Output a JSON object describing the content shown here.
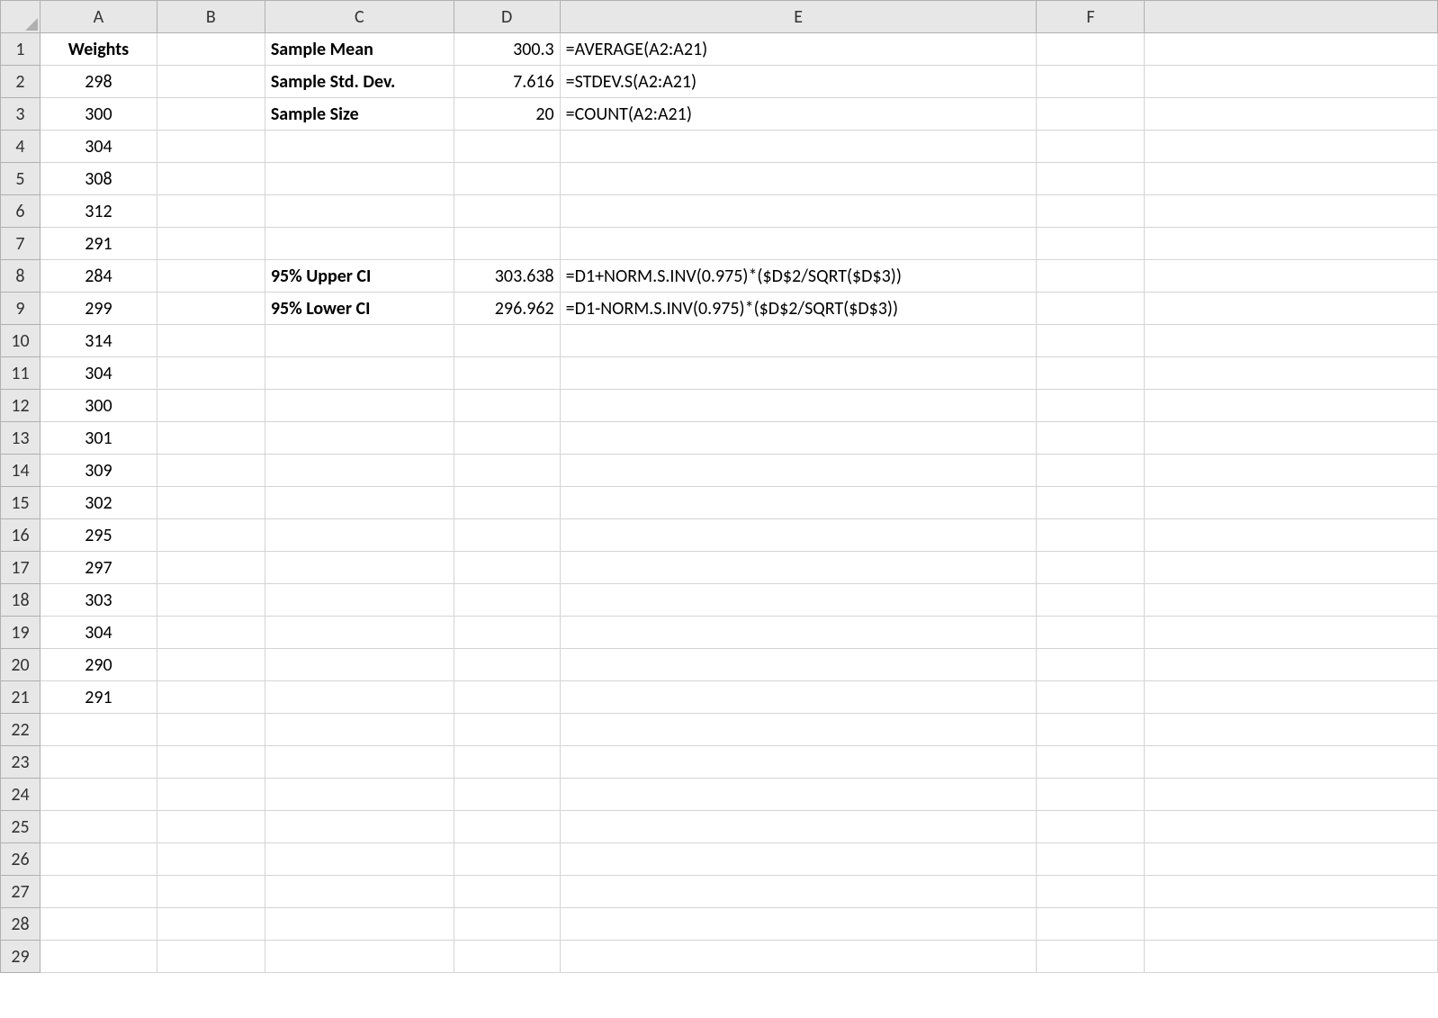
{
  "columns": [
    "A",
    "B",
    "C",
    "D",
    "E",
    "F"
  ],
  "rowCount": 29,
  "cells": {
    "A1": {
      "value": "Weights",
      "bold": true,
      "align": "center"
    },
    "A2": {
      "value": "298",
      "align": "center"
    },
    "A3": {
      "value": "300",
      "align": "center"
    },
    "A4": {
      "value": "304",
      "align": "center"
    },
    "A5": {
      "value": "308",
      "align": "center"
    },
    "A6": {
      "value": "312",
      "align": "center"
    },
    "A7": {
      "value": "291",
      "align": "center"
    },
    "A8": {
      "value": "284",
      "align": "center"
    },
    "A9": {
      "value": "299",
      "align": "center"
    },
    "A10": {
      "value": "314",
      "align": "center"
    },
    "A11": {
      "value": "304",
      "align": "center"
    },
    "A12": {
      "value": "300",
      "align": "center"
    },
    "A13": {
      "value": "301",
      "align": "center"
    },
    "A14": {
      "value": "309",
      "align": "center"
    },
    "A15": {
      "value": "302",
      "align": "center"
    },
    "A16": {
      "value": "295",
      "align": "center"
    },
    "A17": {
      "value": "297",
      "align": "center"
    },
    "A18": {
      "value": "303",
      "align": "center"
    },
    "A19": {
      "value": "304",
      "align": "center"
    },
    "A20": {
      "value": "290",
      "align": "center"
    },
    "A21": {
      "value": "291",
      "align": "center"
    },
    "C1": {
      "value": "Sample Mean",
      "bold": true,
      "align": "left"
    },
    "C2": {
      "value": "Sample Std. Dev.",
      "bold": true,
      "align": "left"
    },
    "C3": {
      "value": "Sample Size",
      "bold": true,
      "align": "left"
    },
    "C8": {
      "value": "95% Upper CI",
      "bold": true,
      "align": "left"
    },
    "C9": {
      "value": "95% Lower CI",
      "bold": true,
      "align": "left"
    },
    "D1": {
      "value": "300.3",
      "align": "right"
    },
    "D2": {
      "value": "7.616",
      "align": "right"
    },
    "D3": {
      "value": "20",
      "align": "right"
    },
    "D8": {
      "value": "303.638",
      "align": "right"
    },
    "D9": {
      "value": "296.962",
      "align": "right"
    },
    "E1": {
      "value": "=AVERAGE(A2:A21)",
      "align": "left"
    },
    "E2": {
      "value": "=STDEV.S(A2:A21)",
      "align": "left"
    },
    "E3": {
      "value": "=COUNT(A2:A21)",
      "align": "left"
    },
    "E8": {
      "value": "=D1+NORM.S.INV(0.975)*($D$2/SQRT($D$3))",
      "align": "left"
    },
    "E9": {
      "value": "=D1-NORM.S.INV(0.975)*($D$2/SQRT($D$3))",
      "align": "left"
    }
  }
}
